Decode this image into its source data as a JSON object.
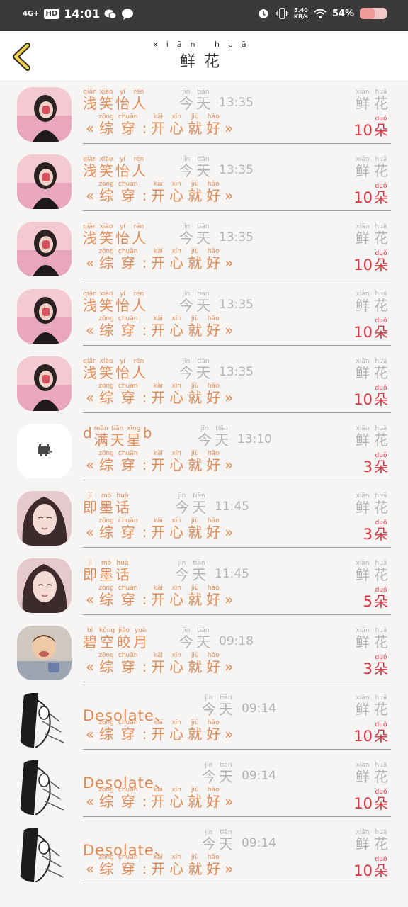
{
  "status_bar": {
    "network": "4G+",
    "hd": "HD",
    "time": "14:01",
    "speed": "5.40",
    "speed_unit": "KB/s",
    "battery": "54%",
    "battery_level": 0.54
  },
  "header": {
    "title_pinyin": [
      "xiān",
      "huā"
    ],
    "title": [
      "鲜",
      "花"
    ]
  },
  "list": [
    {
      "name_rb": [
        [
          "qiǎn",
          "浅"
        ],
        [
          "xiào",
          "笑"
        ],
        [
          "yí",
          "怡"
        ],
        [
          "rén",
          "人"
        ]
      ],
      "name_plain": "",
      "time": "13:35",
      "count": "10",
      "avatar": "girl-pink"
    },
    {
      "name_rb": [
        [
          "qiǎn",
          "浅"
        ],
        [
          "xiào",
          "笑"
        ],
        [
          "yí",
          "怡"
        ],
        [
          "rén",
          "人"
        ]
      ],
      "name_plain": "",
      "time": "13:35",
      "count": "10",
      "avatar": "girl-pink"
    },
    {
      "name_rb": [
        [
          "qiǎn",
          "浅"
        ],
        [
          "xiào",
          "笑"
        ],
        [
          "yí",
          "怡"
        ],
        [
          "rén",
          "人"
        ]
      ],
      "name_plain": "",
      "time": "13:35",
      "count": "10",
      "avatar": "girl-pink"
    },
    {
      "name_rb": [
        [
          "qiǎn",
          "浅"
        ],
        [
          "xiào",
          "笑"
        ],
        [
          "yí",
          "怡"
        ],
        [
          "rén",
          "人"
        ]
      ],
      "name_plain": "",
      "time": "13:35",
      "count": "10",
      "avatar": "girl-pink"
    },
    {
      "name_rb": [
        [
          "qiǎn",
          "浅"
        ],
        [
          "xiào",
          "笑"
        ],
        [
          "yí",
          "怡"
        ],
        [
          "rén",
          "人"
        ]
      ],
      "name_plain": "",
      "time": "13:35",
      "count": "10",
      "avatar": "girl-pink"
    },
    {
      "name_rb": [
        [
          "",
          "d"
        ],
        [
          "mǎn",
          "满"
        ],
        [
          "tiān",
          "天"
        ],
        [
          "xīng",
          "星"
        ],
        [
          "",
          "b"
        ]
      ],
      "name_plain": "",
      "time": "13:10",
      "count": "3",
      "avatar": "cat-white"
    },
    {
      "name_rb": [
        [
          "jí",
          "即"
        ],
        [
          "mò",
          "墨"
        ],
        [
          "huà",
          "话"
        ]
      ],
      "name_plain": "",
      "time": "11:45",
      "count": "3",
      "avatar": "woman-portrait"
    },
    {
      "name_rb": [
        [
          "jí",
          "即"
        ],
        [
          "mò",
          "墨"
        ],
        [
          "huà",
          "话"
        ]
      ],
      "name_plain": "",
      "time": "11:45",
      "count": "5",
      "avatar": "woman-portrait"
    },
    {
      "name_rb": [
        [
          "bì",
          "碧"
        ],
        [
          "kōng",
          "空"
        ],
        [
          "jiǎo",
          "皎"
        ],
        [
          "yuè",
          "月"
        ]
      ],
      "name_plain": "",
      "time": "09:18",
      "count": "3",
      "avatar": "child"
    },
    {
      "name_rb": [],
      "name_plain": "Desolate、",
      "time": "09:14",
      "count": "10",
      "avatar": "manga"
    },
    {
      "name_rb": [],
      "name_plain": "Desolate、",
      "time": "09:14",
      "count": "10",
      "avatar": "manga"
    },
    {
      "name_rb": [],
      "name_plain": "Desolate、",
      "time": "09:14",
      "count": "10",
      "avatar": "manga"
    }
  ],
  "labels": {
    "today": [
      [
        "jīn",
        "今"
      ],
      [
        "tiān",
        "天"
      ]
    ],
    "gift_open": "«",
    "gift_close": "»",
    "gift": [
      [
        "zōng",
        "综"
      ],
      [
        "chuān",
        "穿"
      ],
      [
        "",
        ":"
      ],
      [
        "kāi",
        "开"
      ],
      [
        "xīn",
        "心"
      ],
      [
        "jiù",
        "就"
      ],
      [
        "hǎo",
        "好"
      ]
    ],
    "flower": [
      [
        "xiān",
        "鲜"
      ],
      [
        "huā",
        "花"
      ]
    ],
    "unit": [
      "duǒ",
      "朵"
    ]
  },
  "colors": {
    "accent": "#e28a54",
    "count": "#d8333f",
    "muted": "#b4b4b4",
    "background": "#f7f4f4"
  },
  "icons": {
    "back": "chevron-left-icon",
    "alarm": "alarm-icon",
    "vibrate": "vibrate-icon",
    "wifi": "wifi-icon",
    "wechat": "wechat-icon",
    "message": "message-icon"
  }
}
